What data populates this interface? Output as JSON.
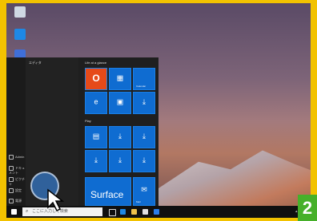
{
  "step_number": "2",
  "colors": {
    "frame": "#f2c200",
    "tile": "#0f6cd1",
    "office": "#e64a19",
    "badge": "#46b02a"
  },
  "start_menu": {
    "left_header": "エディタ",
    "group1_label": "Life at a glance",
    "group2_label": "Play",
    "rail_items": [
      {
        "label": "Admin",
        "icon": "user-icon"
      },
      {
        "label": "ドキュメント",
        "icon": "document-icon"
      },
      {
        "label": "ピクチャ",
        "icon": "pictures-icon"
      },
      {
        "label": "設定",
        "icon": "gear-icon"
      },
      {
        "label": "電源",
        "icon": "power-icon"
      }
    ],
    "tiles": {
      "surface_label": "Surface",
      "mail_tile_caption": "Mail",
      "calendar_caption": "Calendar"
    }
  },
  "taskbar": {
    "search_placeholder": "ここに入力して検索"
  }
}
